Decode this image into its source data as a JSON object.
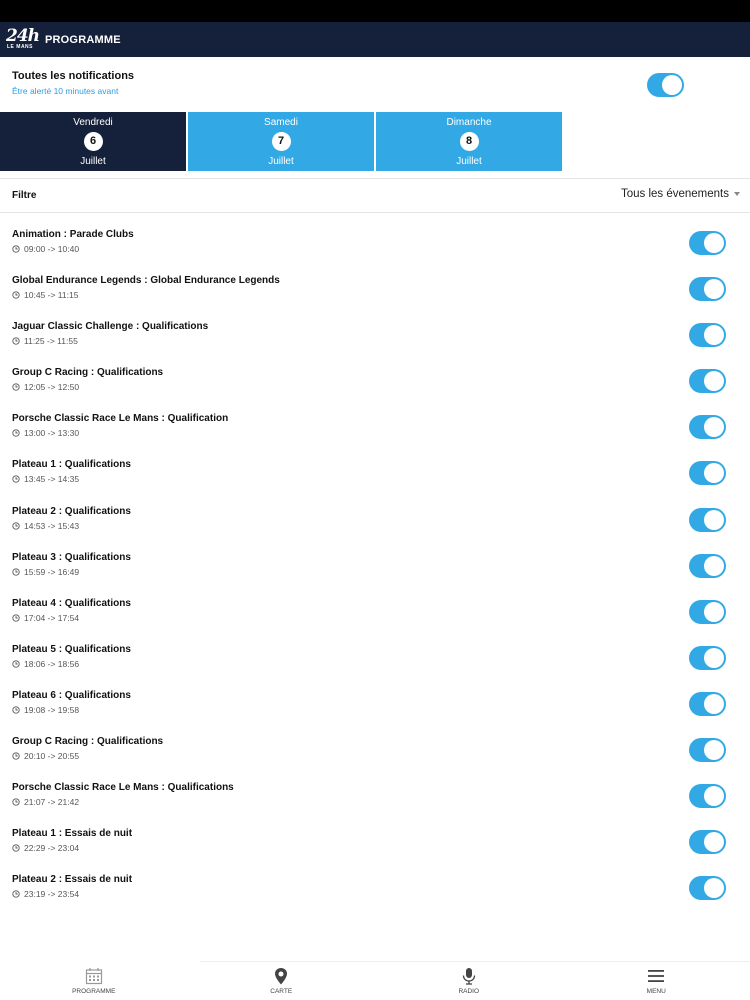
{
  "app": {
    "logo_main": "24h",
    "logo_sub": "LE MANS",
    "title": "PROGRAMME"
  },
  "notifications": {
    "title": "Toutes les notifications",
    "subtitle": "Être alerté 10 minutes avant",
    "enabled": true
  },
  "days": [
    {
      "name": "Vendredi",
      "number": "6",
      "month": "Juillet",
      "active": true
    },
    {
      "name": "Samedi",
      "number": "7",
      "month": "Juillet",
      "active": false
    },
    {
      "name": "Dimanche",
      "number": "8",
      "month": "Juillet",
      "active": false
    }
  ],
  "filter": {
    "label": "Filtre",
    "selected": "Tous les évenements"
  },
  "events": [
    {
      "title": "Animation : Parade Clubs",
      "time": "09:00 -> 10:40",
      "enabled": true
    },
    {
      "title": "Global Endurance Legends : Global Endurance Legends",
      "time": "10:45 -> 11:15",
      "enabled": true
    },
    {
      "title": "Jaguar Classic Challenge : Qualifications",
      "time": "11:25 -> 11:55",
      "enabled": true
    },
    {
      "title": "Group C Racing : Qualifications",
      "time": "12:05 -> 12:50",
      "enabled": true
    },
    {
      "title": "Porsche Classic Race Le Mans : Qualification",
      "time": "13:00 -> 13:30",
      "enabled": true
    },
    {
      "title": "Plateau 1 : Qualifications",
      "time": "13:45 -> 14:35",
      "enabled": true
    },
    {
      "title": "Plateau 2 : Qualifications",
      "time": "14:53 -> 15:43",
      "enabled": true
    },
    {
      "title": "Plateau 3 : Qualifications",
      "time": "15:59 -> 16:49",
      "enabled": true
    },
    {
      "title": "Plateau 4 : Qualifications",
      "time": "17:04 -> 17:54",
      "enabled": true
    },
    {
      "title": "Plateau 5 : Qualifications",
      "time": "18:06 -> 18:56",
      "enabled": true
    },
    {
      "title": "Plateau 6 : Qualifications",
      "time": "19:08 -> 19:58",
      "enabled": true
    },
    {
      "title": "Group C Racing : Qualifications",
      "time": "20:10 -> 20:55",
      "enabled": true
    },
    {
      "title": "Porsche Classic Race Le Mans : Qualifications",
      "time": "21:07 -> 21:42",
      "enabled": true
    },
    {
      "title": "Plateau 1 : Essais de nuit",
      "time": "22:29 -> 23:04",
      "enabled": true
    },
    {
      "title": "Plateau 2 : Essais de nuit",
      "time": "23:19 -> 23:54",
      "enabled": true
    }
  ],
  "bottom_nav": [
    {
      "label": "PROGRAMME",
      "icon": "calendar-icon"
    },
    {
      "label": "CARTE",
      "icon": "map-pin-icon"
    },
    {
      "label": "RADIO",
      "icon": "microphone-icon"
    },
    {
      "label": "MENU",
      "icon": "hamburger-menu-icon"
    }
  ],
  "colors": {
    "navy": "#15213a",
    "accent_blue": "#32a9e5",
    "subtitle_blue": "#2b9fe0"
  }
}
